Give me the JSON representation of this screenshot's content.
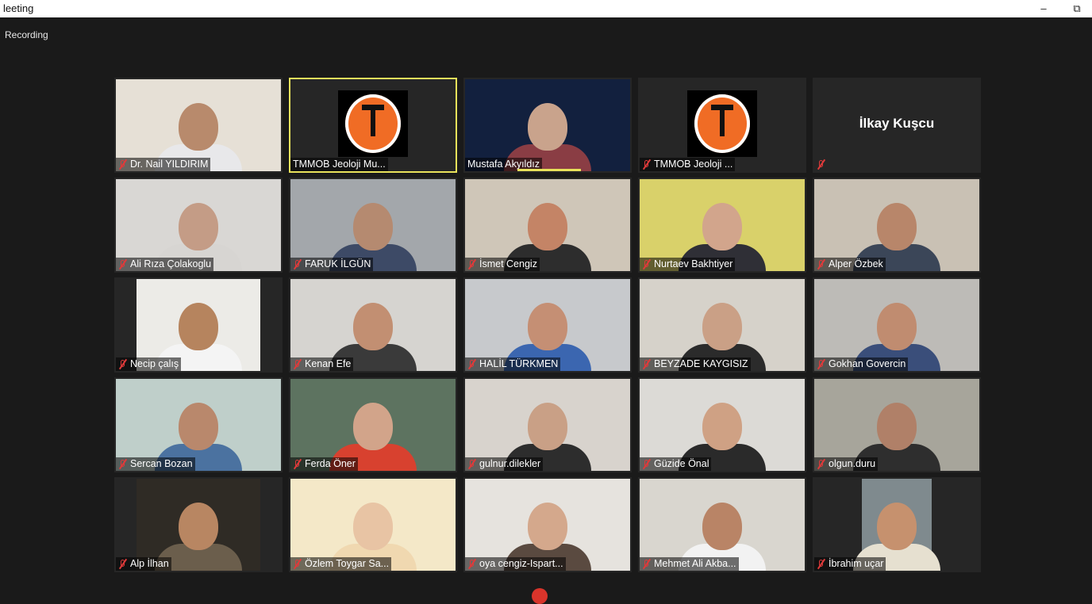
{
  "window": {
    "title": "leeting",
    "minimize_symbol": "–",
    "restore_symbol": "⧉"
  },
  "recording_label": "Recording",
  "colors": {
    "active_speaker_border": "#e9e25b",
    "muted_icon": "#e03a3a",
    "logo_orange": "#f06c25"
  },
  "participants": [
    {
      "name": "Dr. Nail YILDIRIM",
      "muted": true,
      "type": "video",
      "bg": "#e6e0d6",
      "body": "#e8e8ea",
      "skin": "#b88a6c"
    },
    {
      "name": "TMMOB Jeoloji Mu...",
      "muted": false,
      "type": "logo",
      "active": true
    },
    {
      "name": "Mustafa Akyıldız",
      "muted": false,
      "type": "video",
      "bg": "#12203e",
      "body": "#8a3d44",
      "skin": "#c9a38c"
    },
    {
      "name": "TMMOB Jeoloji ...",
      "muted": true,
      "type": "logo"
    },
    {
      "name": "",
      "display_name": "İlkay Kuşcu",
      "muted": true,
      "type": "name"
    },
    {
      "name": "Ali Rıza Çolakoglu",
      "muted": true,
      "type": "video",
      "bg": "#d9d7d4",
      "body": "#d7d5d2",
      "skin": "#c49c86"
    },
    {
      "name": "FARUK İLGÜN",
      "muted": true,
      "type": "video",
      "bg": "#a3a7ab",
      "body": "#3d4a66",
      "skin": "#b58a70"
    },
    {
      "name": "İsmet Cengiz",
      "muted": true,
      "type": "video",
      "bg": "#cfc6b8",
      "body": "#2d2d2d",
      "skin": "#c48466"
    },
    {
      "name": "Nurtaev Bakhtiyer",
      "muted": true,
      "type": "video",
      "bg": "#d9d16a",
      "body": "#2f2f36",
      "skin": "#d2a58c"
    },
    {
      "name": "Alper Özbek",
      "muted": true,
      "type": "video",
      "bg": "#c9c1b4",
      "body": "#3b4658",
      "skin": "#b8866a"
    },
    {
      "name": "Necip çalış",
      "muted": true,
      "type": "video",
      "bg": "#ecebe7",
      "body": "#f4f4f4",
      "skin": "#b6845e",
      "narrow": true
    },
    {
      "name": "Kenan Efe",
      "muted": true,
      "type": "video",
      "bg": "#d6d4d0",
      "body": "#3a3a3a",
      "skin": "#c28f72"
    },
    {
      "name": "HALİL TÜRKMEN",
      "muted": true,
      "type": "video",
      "bg": "#c7c9cc",
      "body": "#3b66b0",
      "skin": "#c58f74"
    },
    {
      "name": "BEYZADE KAYGISIZ",
      "muted": true,
      "type": "video",
      "bg": "#d6d2ca",
      "body": "#2b2b2b",
      "skin": "#caa086"
    },
    {
      "name": "Gokhan Govercin",
      "muted": true,
      "type": "video",
      "bg": "#bdbbb7",
      "body": "#3a4e7a",
      "skin": "#c08c70"
    },
    {
      "name": "Sercan  Bozan",
      "muted": true,
      "type": "video",
      "bg": "#bfcfca",
      "body": "#4b72a0",
      "skin": "#b9886c"
    },
    {
      "name": "Ferda Öner",
      "muted": true,
      "type": "video",
      "bg": "#5d7360",
      "body": "#d8412f",
      "skin": "#d2a48a"
    },
    {
      "name": "gulnur.dilekler",
      "muted": true,
      "type": "video",
      "bg": "#d8d3cd",
      "body": "#2d2d2d",
      "skin": "#c9a086"
    },
    {
      "name": "Güzide Önal",
      "muted": true,
      "type": "video",
      "bg": "#dcdad6",
      "body": "#2a2a2a",
      "skin": "#cfa184"
    },
    {
      "name": "olgun.duru",
      "muted": true,
      "type": "video",
      "bg": "#a7a59b",
      "body": "#2e2e2e",
      "skin": "#b08068"
    },
    {
      "name": "Alp İlhan",
      "muted": true,
      "type": "video",
      "bg": "#2f2b25",
      "body": "#6b5e4c",
      "skin": "#b88662",
      "narrow": true
    },
    {
      "name": "Özlem Toygar Sa...",
      "muted": true,
      "type": "video",
      "bg": "#f4e8c8",
      "body": "#f0d8b0",
      "skin": "#e8c4a4"
    },
    {
      "name": "oya cengiz-Ispart...",
      "muted": true,
      "type": "video",
      "bg": "#e6e3de",
      "body": "#5a4a40",
      "skin": "#d4a88c"
    },
    {
      "name": "Mehmet Ali Akba...",
      "muted": true,
      "type": "video",
      "bg": "#d9d6cf",
      "body": "#f2f2f2",
      "skin": "#b98466"
    },
    {
      "name": "İbrahim uçar",
      "muted": true,
      "type": "video",
      "bg": "#7f8a8e",
      "body": "#e6e0d0",
      "skin": "#c6916e",
      "narrow2": true
    }
  ]
}
